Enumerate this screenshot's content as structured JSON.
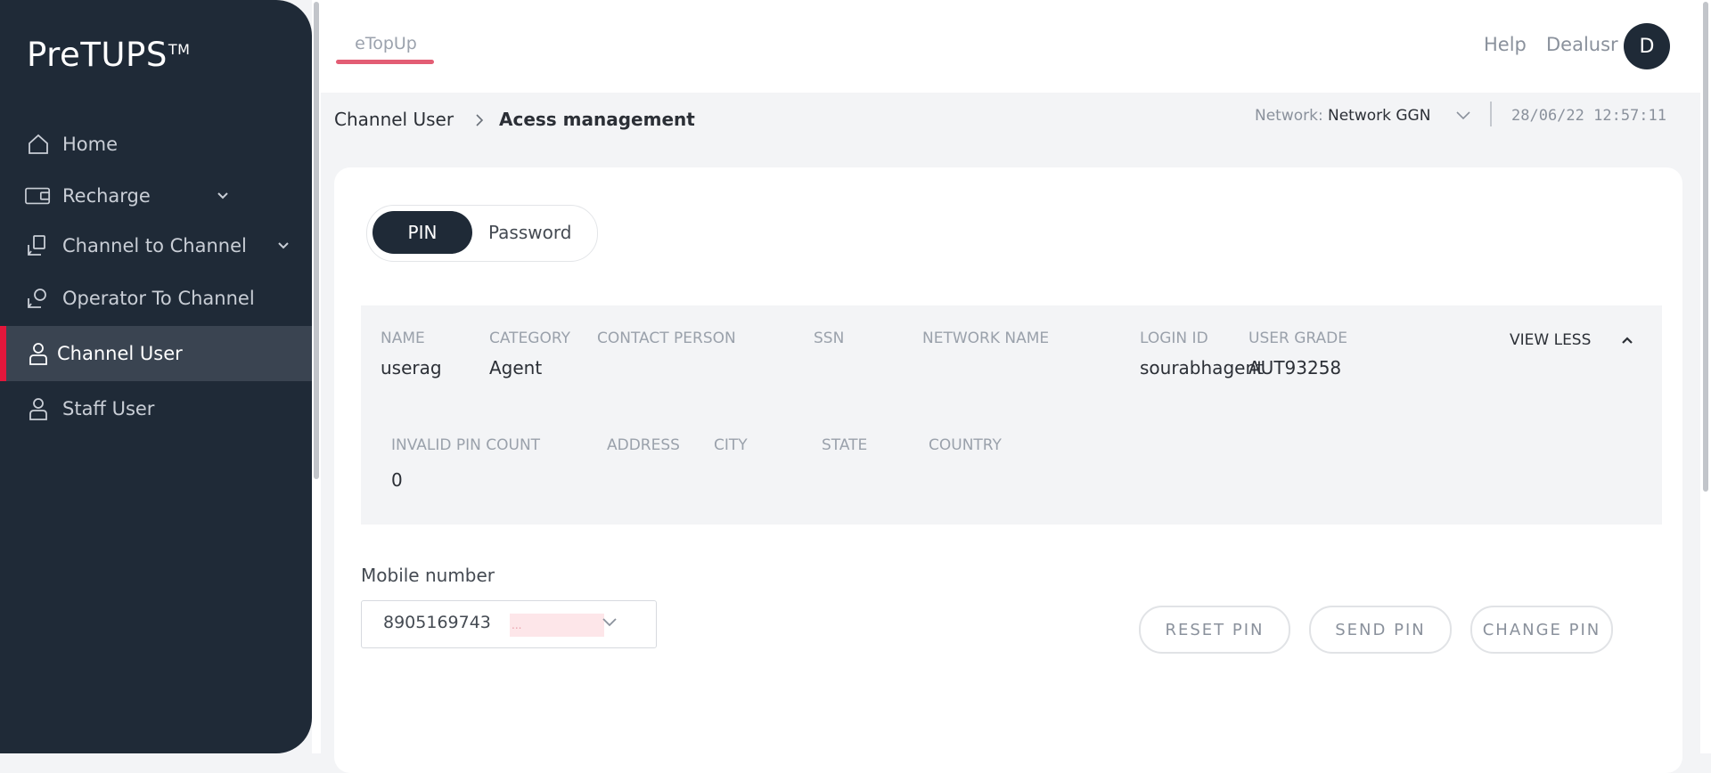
{
  "sidebar": {
    "logo": "PreTUPS",
    "logo_tm": "TM",
    "items": [
      {
        "label": "Home",
        "icon": "home-icon"
      },
      {
        "label": "Recharge",
        "icon": "recharge-icon"
      },
      {
        "label": "Channel to Channel",
        "icon": "channel-transfer-icon"
      },
      {
        "label": "Operator To Channel",
        "icon": "operator-icon"
      },
      {
        "label": "Channel User",
        "icon": "user-icon"
      },
      {
        "label": "Staff User",
        "icon": "user-icon"
      }
    ],
    "active": "Channel User"
  },
  "header": {
    "tab": "eTopUp",
    "help": "Help",
    "username": "Dealusr",
    "avatar_initial": "D"
  },
  "breadcrumb": {
    "parent": "Channel User",
    "current": "Acess management"
  },
  "network": {
    "label": "Network:",
    "value": "Network GGN"
  },
  "datetime": "28/06/22 12:57:11",
  "toggle": {
    "options": [
      "PIN",
      "Password"
    ],
    "selected": "PIN"
  },
  "user_details": {
    "name_label": "NAME",
    "name": "userag",
    "category_label": "CATEGORY",
    "category": "Agent",
    "contact_person_label": "CONTACT PERSON",
    "contact_person": "",
    "ssn_label": "SSN",
    "ssn": "",
    "network_name_label": "NETWORK NAME",
    "network_name": "",
    "login_id_label": "LOGIN ID",
    "login_id": "sourabhagent",
    "user_grade_label": "USER GRADE",
    "user_grade": "AUT93258",
    "view_less": "VIEW LESS",
    "invalid_pin_count_label": "INVALID PIN COUNT",
    "invalid_pin_count": "0",
    "address_label": "ADDRESS",
    "address": "",
    "city_label": "CITY",
    "city": "",
    "state_label": "STATE",
    "state": "",
    "country_label": "COUNTRY",
    "country": ""
  },
  "mobile": {
    "label": "Mobile number",
    "value": "8905169743",
    "masked": "..."
  },
  "actions": {
    "reset": "RESET PIN",
    "send": "SEND PIN",
    "change": "CHANGE PIN"
  },
  "colors": {
    "sidebar_bg": "#1f2a37",
    "active_accent": "#e3173b",
    "tab_underline": "#e35d74"
  }
}
